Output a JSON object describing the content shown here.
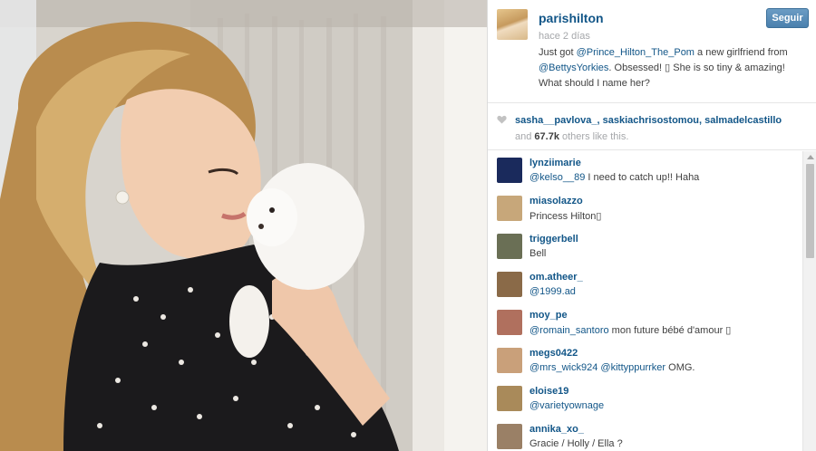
{
  "post": {
    "username": "parishilton",
    "time": "hace 2 días",
    "follow_label": "Seguir",
    "caption_parts": {
      "t1": "Just got ",
      "m1": "@Prince_Hilton_The_Pom",
      "t2": " a new girlfriend from ",
      "m2": "@BettysYorkies",
      "t3": ". Obsessed! ▯ She is so tiny & amazing! What should I name her?"
    }
  },
  "likes": {
    "users": [
      "sasha__pavlova_",
      "saskiachrisostomou",
      "salmadelcastillo"
    ],
    "sep1": ", ",
    "sep2": ", ",
    "and_label": "and ",
    "count": "67.7k",
    "suffix": " others like this."
  },
  "comments": [
    {
      "user": "lynziimarie",
      "mention": "@kelso__89",
      "text": " I need to catch up!! Haha",
      "avatar_color": "#1a2a5c"
    },
    {
      "user": "miasolazzo",
      "mention": "",
      "text": "Princess Hilton▯",
      "avatar_color": "#c7a77a"
    },
    {
      "user": "triggerbell",
      "mention": "",
      "text": "Bell",
      "avatar_color": "#6a6f55"
    },
    {
      "user": "om.atheer_",
      "mention": "@1999.ad",
      "text": "",
      "avatar_color": "#8a6a48"
    },
    {
      "user": "moy_pe",
      "mention": "@romain_santoro",
      "text": " mon future bébé d'amour ▯",
      "avatar_color": "#b0705e"
    },
    {
      "user": "megs0422",
      "mention": "@mrs_wick924 @kittyppurrker",
      "text": " OMG.",
      "avatar_color": "#c9a07a"
    },
    {
      "user": "eloise19",
      "mention": "@varietyownage",
      "text": "",
      "avatar_color": "#a98a5a"
    },
    {
      "user": "annika_xo_",
      "mention": "",
      "text": "Gracie / Holly / Ella ?",
      "avatar_color": "#9a8066"
    }
  ]
}
